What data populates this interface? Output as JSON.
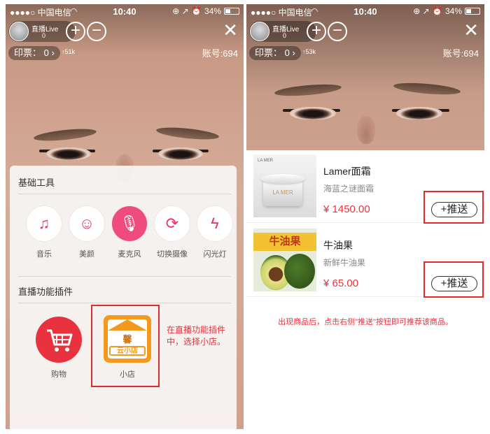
{
  "status": {
    "carrier": "●●●●○ 中国电信",
    "wifi_icon": "wifi-icon",
    "time": "10:40",
    "system_icons": "⊕ ↗ ⏰",
    "battery": "34%"
  },
  "live": {
    "name": "直播Live",
    "count": "0",
    "plus": "+",
    "minus": "−",
    "close": "✕",
    "ticket_label": "印票：",
    "ticket_value": "0",
    "ticket_arrow": "›",
    "left_rise": "↑51k",
    "right_rise": "↑53k",
    "account": "账号:694"
  },
  "tools": {
    "title": "基础工具",
    "items": [
      {
        "label": "音乐",
        "icon": "music-icon",
        "glyph": "♫"
      },
      {
        "label": "美颜",
        "icon": "beauty-icon",
        "glyph": "☺"
      },
      {
        "label": "麦克风",
        "icon": "microphone-icon",
        "glyph": "🎙"
      },
      {
        "label": "切换摄像",
        "icon": "camera-switch-icon",
        "glyph": "⟳"
      },
      {
        "label": "闪光灯",
        "icon": "flash-off-icon",
        "glyph": "ϟ"
      }
    ],
    "active_index": 2
  },
  "plugins": {
    "title": "直播功能插件",
    "items": [
      {
        "label": "购物",
        "icon": "shopping-cart-icon",
        "glyph": "🛒"
      },
      {
        "label": "小店",
        "icon": "store-icon",
        "store_text": "云小店",
        "store_glyph": "馨"
      }
    ]
  },
  "left_hint": "在直播功能插件中，选择小店。",
  "products": [
    {
      "name": "Lamer面霜",
      "desc": "海蓝之谜面霜",
      "price": "¥ 1450.00",
      "button": "+推送",
      "thumb_brand": "LA MER",
      "jar_label": "LA MER"
    },
    {
      "name": "牛油果",
      "desc": "新鲜牛油果",
      "price": "¥ 65.00",
      "button": "+推送",
      "banner": "牛油果"
    }
  ],
  "right_note": "出现商品后，点击右侧\"推送\"按钮即可推荐该商品。",
  "colors": {
    "accent": "#e8333f",
    "active_tool": "#ef4b7e",
    "store": "#f39a1e"
  }
}
